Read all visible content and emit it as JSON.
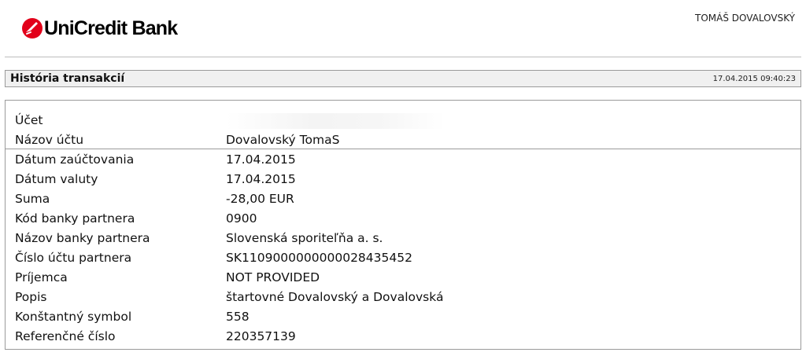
{
  "header": {
    "brand": "UniCredit Bank",
    "user_name": "TOMÁŠ DOVALOVSKÝ",
    "brand_color": "#e2001a"
  },
  "section": {
    "title": "História transakcií",
    "timestamp": "17.04.2015 09:40:23"
  },
  "account": {
    "label": "Účet",
    "value": ""
  },
  "details": [
    {
      "label": "Názov účtu",
      "value": "Dovalovský TomaS"
    },
    {
      "label": "Dátum zaúčtovania",
      "value": "17.04.2015"
    },
    {
      "label": "Dátum valuty",
      "value": "17.04.2015"
    },
    {
      "label": "Suma",
      "value": "-28,00 EUR"
    },
    {
      "label": "Kód banky partnera",
      "value": "0900"
    },
    {
      "label": "Názov banky partnera",
      "value": "Slovenská sporiteľňa a. s."
    },
    {
      "label": "Číslo účtu partnera",
      "value": "SK1109000000000028435452"
    },
    {
      "label": "Príjemca",
      "value": "NOT PROVIDED"
    },
    {
      "label": "Popis",
      "value": "štartovné Dovalovský a Dovalovská"
    },
    {
      "label": "Konštantný symbol",
      "value": "558"
    },
    {
      "label": "Referenčné číslo",
      "value": "220357139"
    }
  ]
}
